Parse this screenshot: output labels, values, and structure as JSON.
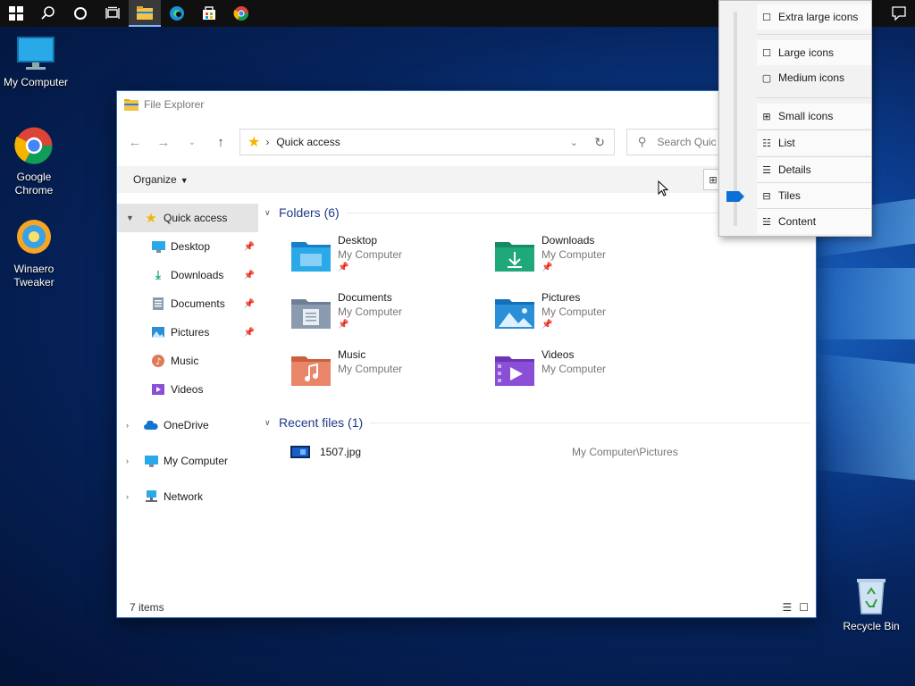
{
  "desktop": {
    "icons": [
      {
        "label": "My Computer"
      },
      {
        "label": "Google Chrome"
      },
      {
        "label": "Winaero Tweaker"
      },
      {
        "label": "Recycle Bin"
      }
    ]
  },
  "window": {
    "title": "File Explorer",
    "address": "Quick access",
    "search_placeholder": "Search Quic",
    "organize_label": "Organize",
    "status_items": "7 items"
  },
  "nav": {
    "items": [
      {
        "label": "Quick access",
        "icon": "star-icon"
      },
      {
        "label": "Desktop",
        "icon": "desktop-icon"
      },
      {
        "label": "Downloads",
        "icon": "download-icon"
      },
      {
        "label": "Documents",
        "icon": "document-icon"
      },
      {
        "label": "Pictures",
        "icon": "picture-icon"
      },
      {
        "label": "Music",
        "icon": "music-icon"
      },
      {
        "label": "Videos",
        "icon": "video-icon"
      },
      {
        "label": "OneDrive",
        "icon": "cloud-icon"
      },
      {
        "label": "My Computer",
        "icon": "computer-icon"
      },
      {
        "label": "Network",
        "icon": "network-icon"
      }
    ]
  },
  "content": {
    "folders_header": "Folders (6)",
    "folders": [
      {
        "name": "Desktop",
        "sub": "My Computer"
      },
      {
        "name": "Downloads",
        "sub": "My Computer"
      },
      {
        "name": "Documents",
        "sub": "My Computer"
      },
      {
        "name": "Pictures",
        "sub": "My Computer"
      },
      {
        "name": "Music",
        "sub": "My Computer"
      },
      {
        "name": "Videos",
        "sub": "My Computer"
      }
    ],
    "recent_header": "Recent files (1)",
    "recent": [
      {
        "name": "1507.jpg",
        "path": "My Computer\\Pictures"
      }
    ]
  },
  "view_menu": {
    "items": [
      {
        "label": "Extra large icons"
      },
      {
        "label": "Large icons"
      },
      {
        "label": "Medium icons"
      },
      {
        "label": "Small icons"
      },
      {
        "label": "List"
      },
      {
        "label": "Details"
      },
      {
        "label": "Tiles"
      },
      {
        "label": "Content"
      }
    ],
    "selected": "Tiles"
  },
  "colors": {
    "accent": "#0a6fd6",
    "folder_blue": "#2a9fe8",
    "folder_green": "#1fa97a",
    "header_blue": "#1e3a8a"
  }
}
